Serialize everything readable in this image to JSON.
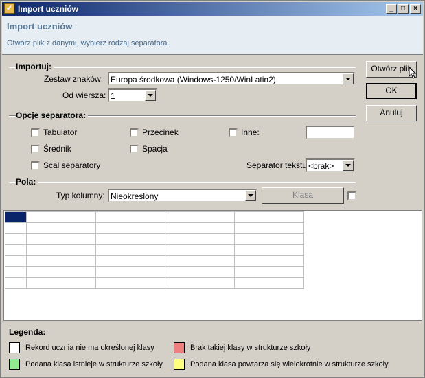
{
  "window": {
    "title": "Import uczniów"
  },
  "header": {
    "title": "Import uczniów",
    "subtitle": "Otwórz plik z danymi, wybierz rodzaj separatora."
  },
  "importuj": {
    "section_label": "Importuj:",
    "charset_label": "Zestaw znaków:",
    "charset_value": "Europa środkowa (Windows-1250/WinLatin2)",
    "from_row_label": "Od wiersza:",
    "from_row_value": "1"
  },
  "separators": {
    "section_label": "Opcje separatora:",
    "tab_label": "Tabulator",
    "comma_label": "Przecinek",
    "other_label": "Inne:",
    "other_value": "",
    "semicolon_label": "Średnik",
    "space_label": "Spacja",
    "merge_label": "Scal separatory",
    "text_sep_label": "Separator tekstu",
    "text_sep_value": "<brak>"
  },
  "fields": {
    "section_label": "Pola:",
    "column_type_label": "Typ kolumny:",
    "column_type_value": "Nieokreślony",
    "class_button": "Klasa"
  },
  "buttons": {
    "open": "Otwórz plik",
    "ok": "OK",
    "cancel": "Anuluj"
  },
  "legend": {
    "title": "Legenda:",
    "items": [
      {
        "text": "Rekord ucznia nie ma określonej klasy",
        "color": "#ffffff"
      },
      {
        "text": "Brak takiej klasy w strukturze szkoły",
        "color": "#f08080"
      },
      {
        "text": "Podana klasa istnieje w strukturze szkoły",
        "color": "#90ee90"
      },
      {
        "text": "Podana klasa powtarza się wielokrotnie w strukturze szkoły",
        "color": "#ffff80"
      }
    ]
  },
  "colors": {
    "title_start": "#0a246a",
    "title_end": "#a6caf0",
    "selected_cell": "#0a246a"
  }
}
